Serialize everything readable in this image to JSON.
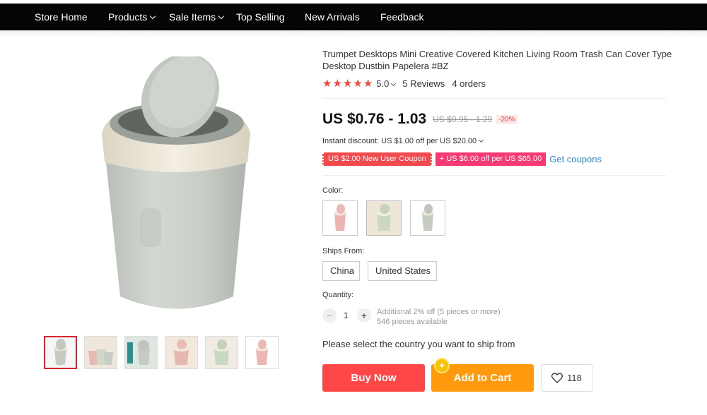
{
  "nav": {
    "items": [
      {
        "label": "Store Home",
        "dropdown": false
      },
      {
        "label": "Products",
        "dropdown": true
      },
      {
        "label": "Sale Items",
        "dropdown": true
      },
      {
        "label": "Top Selling",
        "dropdown": false
      },
      {
        "label": "New Arrivals",
        "dropdown": false
      },
      {
        "label": "Feedback",
        "dropdown": false
      }
    ]
  },
  "product": {
    "title": "Trumpet Desktops Mini Creative Covered Kitchen Living Room Trash Can Cover Type Desktop Dustbin Papelera #BZ",
    "rating": "5.0",
    "stars": 5,
    "reviews": "5 Reviews",
    "orders": "4 orders",
    "price": "US $0.76 - 1.03",
    "old_price": "US $0.95 - 1.29",
    "discount": "-20%",
    "instant_discount": "Instant discount: US $1.00 off per US $20.00",
    "coupon_user": "US $2.00 New User Coupon",
    "coupon_store": "+ US $6.00 off per US $65.00",
    "get_coupons": "Get coupons"
  },
  "options": {
    "color_label": "Color:",
    "colors": [
      "pink",
      "green",
      "grey"
    ],
    "ships_from_label": "Ships From:",
    "ships_from": [
      "China",
      "United States"
    ],
    "quantity_label": "Quantity:",
    "quantity": "1",
    "qty_minus": "−",
    "qty_plus": "+",
    "qty_discount_note": "Additional 2% off (5 pieces or more)",
    "qty_available": "546 pieces available"
  },
  "ship_note": "Please select the country you want to ship from",
  "actions": {
    "buy_now": "Buy Now",
    "add_to_cart": "Add to Cart",
    "wishlist_count": "118"
  },
  "colors": {
    "nav_bg": "#050505",
    "price_red": "#ff4747",
    "cart_orange": "#ff9a0e",
    "star_red": "#f0473c",
    "link_blue": "#2b8ad6",
    "can_grey": "#c9cec7",
    "can_rim": "#ece6d6"
  }
}
